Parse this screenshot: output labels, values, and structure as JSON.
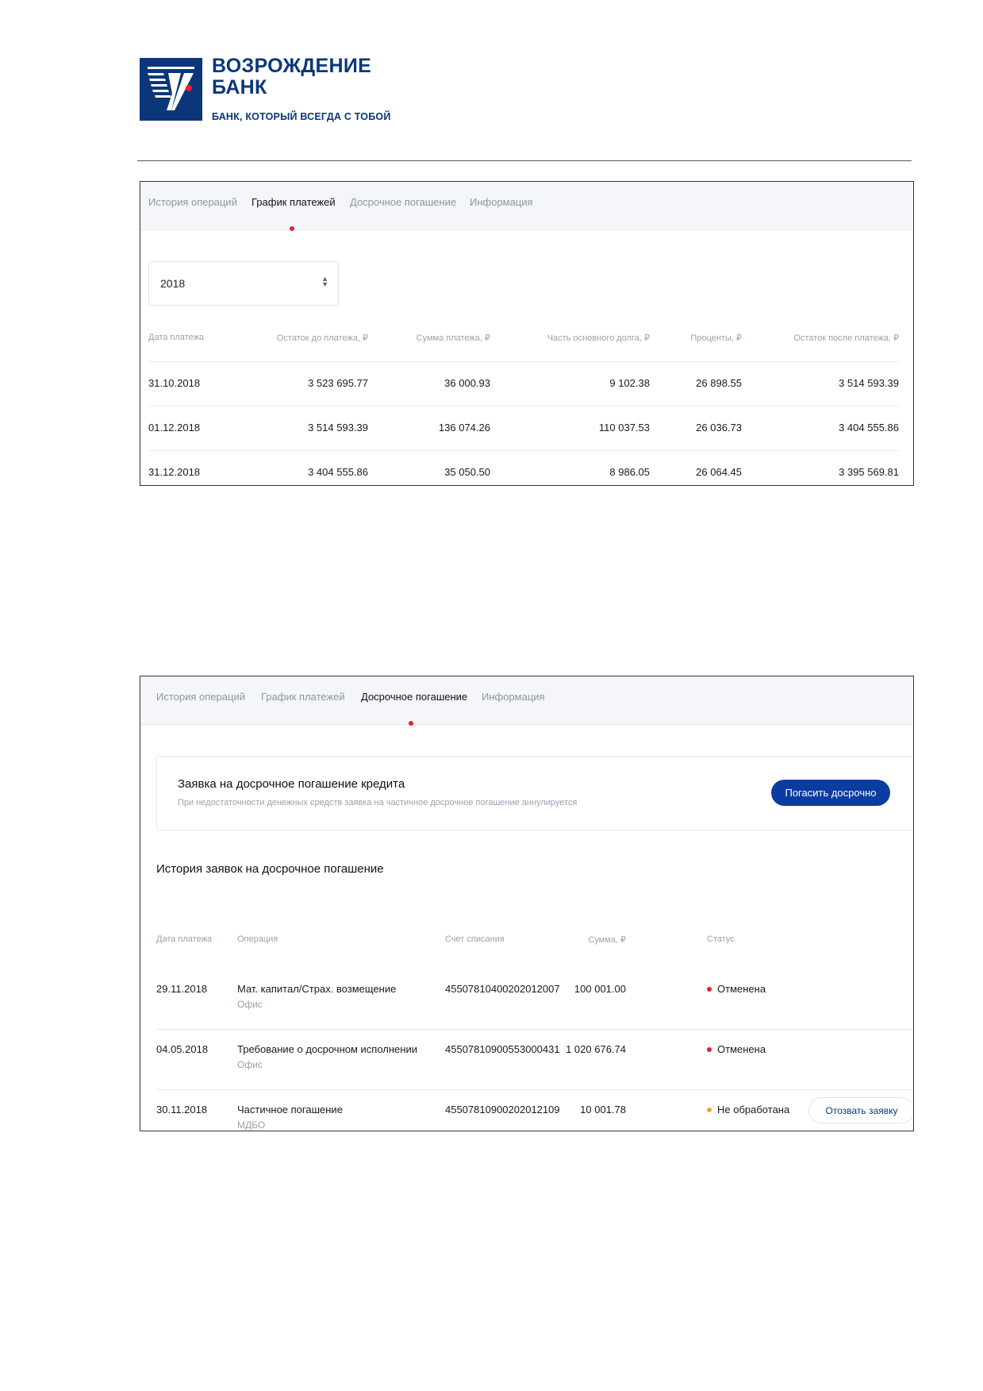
{
  "logo": {
    "name_line1": "ВОЗРОЖДЕНИЕ",
    "name_line2": "БАНК",
    "slogan": "БАНК, КОТОРЫЙ ВСЕГДА С ТОБОЙ",
    "brand_color": "#0b3779",
    "accent_color": "#e4222d"
  },
  "tabs": [
    {
      "label": "История операций"
    },
    {
      "label": "График платежей"
    },
    {
      "label": "Досрочное погашение"
    },
    {
      "label": "Информация"
    }
  ],
  "panel_schedule": {
    "active_tab": "График платежей",
    "year_select": {
      "value": "2018",
      "arrow_up": "▲",
      "arrow_down": "▼"
    },
    "headers": [
      "Дата платежа",
      "Остаток до платежа, ₽",
      "Сумма платежа, ₽",
      "Часть основного долга, ₽",
      "Проценты, ₽",
      "Остаток после платежа, ₽"
    ],
    "rows": [
      [
        "31.10.2018",
        "3 523 695.77",
        "36 000.93",
        "9 102.38",
        "26 898.55",
        "3 514 593.39"
      ],
      [
        "01.12.2018",
        "3 514 593.39",
        "136 074.26",
        "110 037.53",
        "26 036.73",
        "3 404 555.86"
      ],
      [
        "31.12.2018",
        "3 404 555.86",
        "35 050.50",
        "8 986.05",
        "26 064.45",
        "3 395 569.81"
      ]
    ]
  },
  "panel_early": {
    "active_tab": "Досрочное погашение",
    "card": {
      "title": "Заявка на досрочное погашение кредита",
      "note": "При недостаточности денежных средств заявка на частичное досрочное погашение аннулируется",
      "button_label": "Погасить досрочно",
      "button_color": "#0b3da0"
    },
    "history_title": "История заявок на досрочное погашение",
    "headers": [
      "Дата платежа",
      "Операция",
      "Счет списания",
      "Сумма, ₽",
      "Статус"
    ],
    "rows": [
      {
        "date": "29.11.2018",
        "operation": "Мат. капитал/Страх. возмещение",
        "channel": "Офис",
        "account": "45507810400202012007",
        "sum": "100 001.00",
        "status": "Отменена",
        "status_color": "#e4222d"
      },
      {
        "date": "04.05.2018",
        "operation": "Требование о досрочном исполнении",
        "channel": "Офис",
        "account": "45507810900553000431",
        "sum": "1 020 676.74",
        "status": "Отменена",
        "status_color": "#e4222d"
      },
      {
        "date": "30.11.2018",
        "operation": "Частичное погашение",
        "channel": "МДБО",
        "account": "45507810900202012109",
        "sum": "10 001.78",
        "status": "Не обработана",
        "status_color": "#f0a81e",
        "action_label": "Отозвать заявку"
      }
    ]
  }
}
